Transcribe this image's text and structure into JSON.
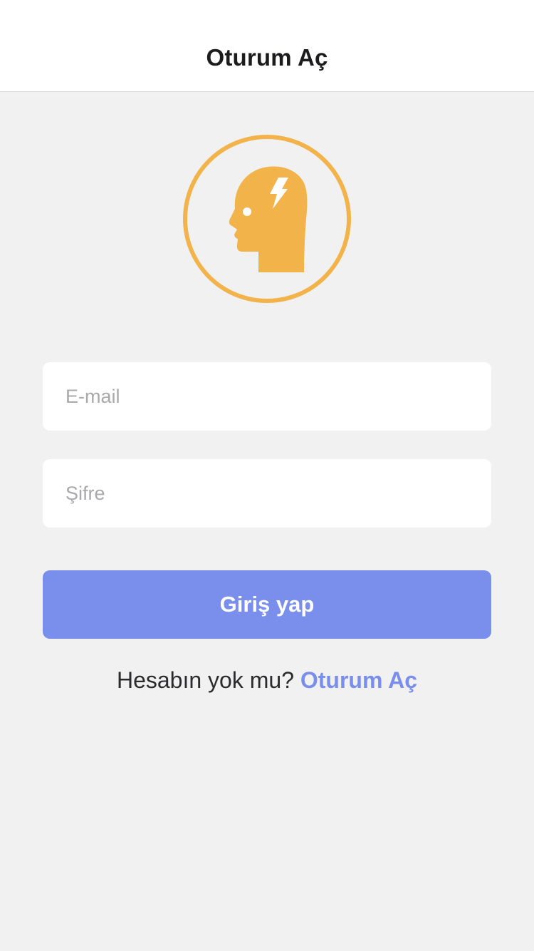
{
  "header": {
    "title": "Oturum Aç"
  },
  "logo": {
    "icon": "head-lightning-icon",
    "color": "#f2b34b"
  },
  "form": {
    "email": {
      "placeholder": "E-mail",
      "value": ""
    },
    "password": {
      "placeholder": "Şifre",
      "value": ""
    },
    "submit_label": "Giriş yap"
  },
  "signup": {
    "prompt": "Hesabın yok mu?",
    "link_label": "Oturum Aç"
  },
  "colors": {
    "accent": "#7a8fec",
    "background": "#f1f1f2",
    "logo": "#f2b34b"
  }
}
